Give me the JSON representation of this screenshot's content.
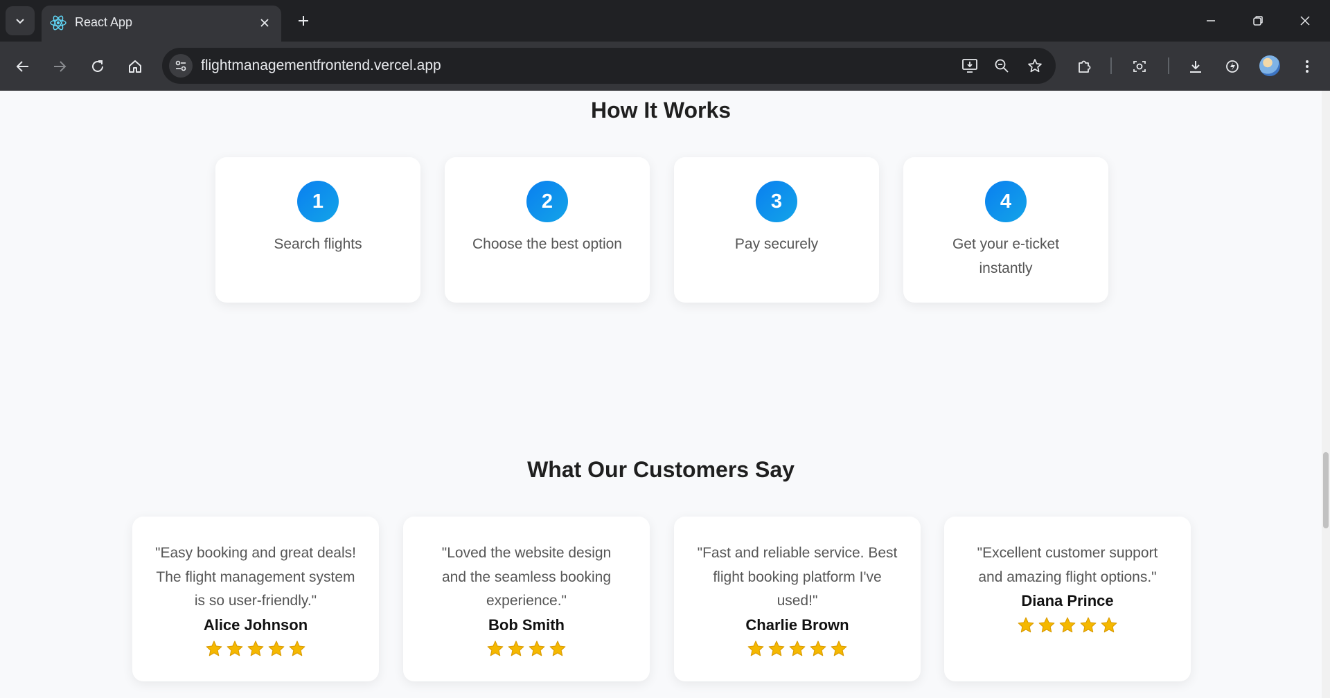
{
  "browser": {
    "tab_title": "React App",
    "url": "flightmanagementfrontend.vercel.app"
  },
  "how_it_works": {
    "title": "How It Works",
    "steps": [
      {
        "number": "1",
        "label": "Search flights"
      },
      {
        "number": "2",
        "label": "Choose the best option"
      },
      {
        "number": "3",
        "label": "Pay securely"
      },
      {
        "number": "4",
        "label": "Get your e-ticket instantly"
      }
    ]
  },
  "testimonials": {
    "title": "What Our Customers Say",
    "reviews": [
      {
        "quote": "\"Easy booking and great deals! The flight management system is so user-friendly.\"",
        "name": "Alice Johnson",
        "rating": 5
      },
      {
        "quote": "\"Loved the website design and the seamless booking experience.\"",
        "name": "Bob Smith",
        "rating": 4
      },
      {
        "quote": "\"Fast and reliable service. Best flight booking platform I've used!\"",
        "name": "Charlie Brown",
        "rating": 5
      },
      {
        "quote": "\"Excellent customer support and amazing flight options.\"",
        "name": "Diana Prince",
        "rating": 5
      }
    ]
  },
  "colors": {
    "step_badge": "#0a7ff0",
    "star": "#f5b800",
    "page_background": "#f8f9fb"
  }
}
